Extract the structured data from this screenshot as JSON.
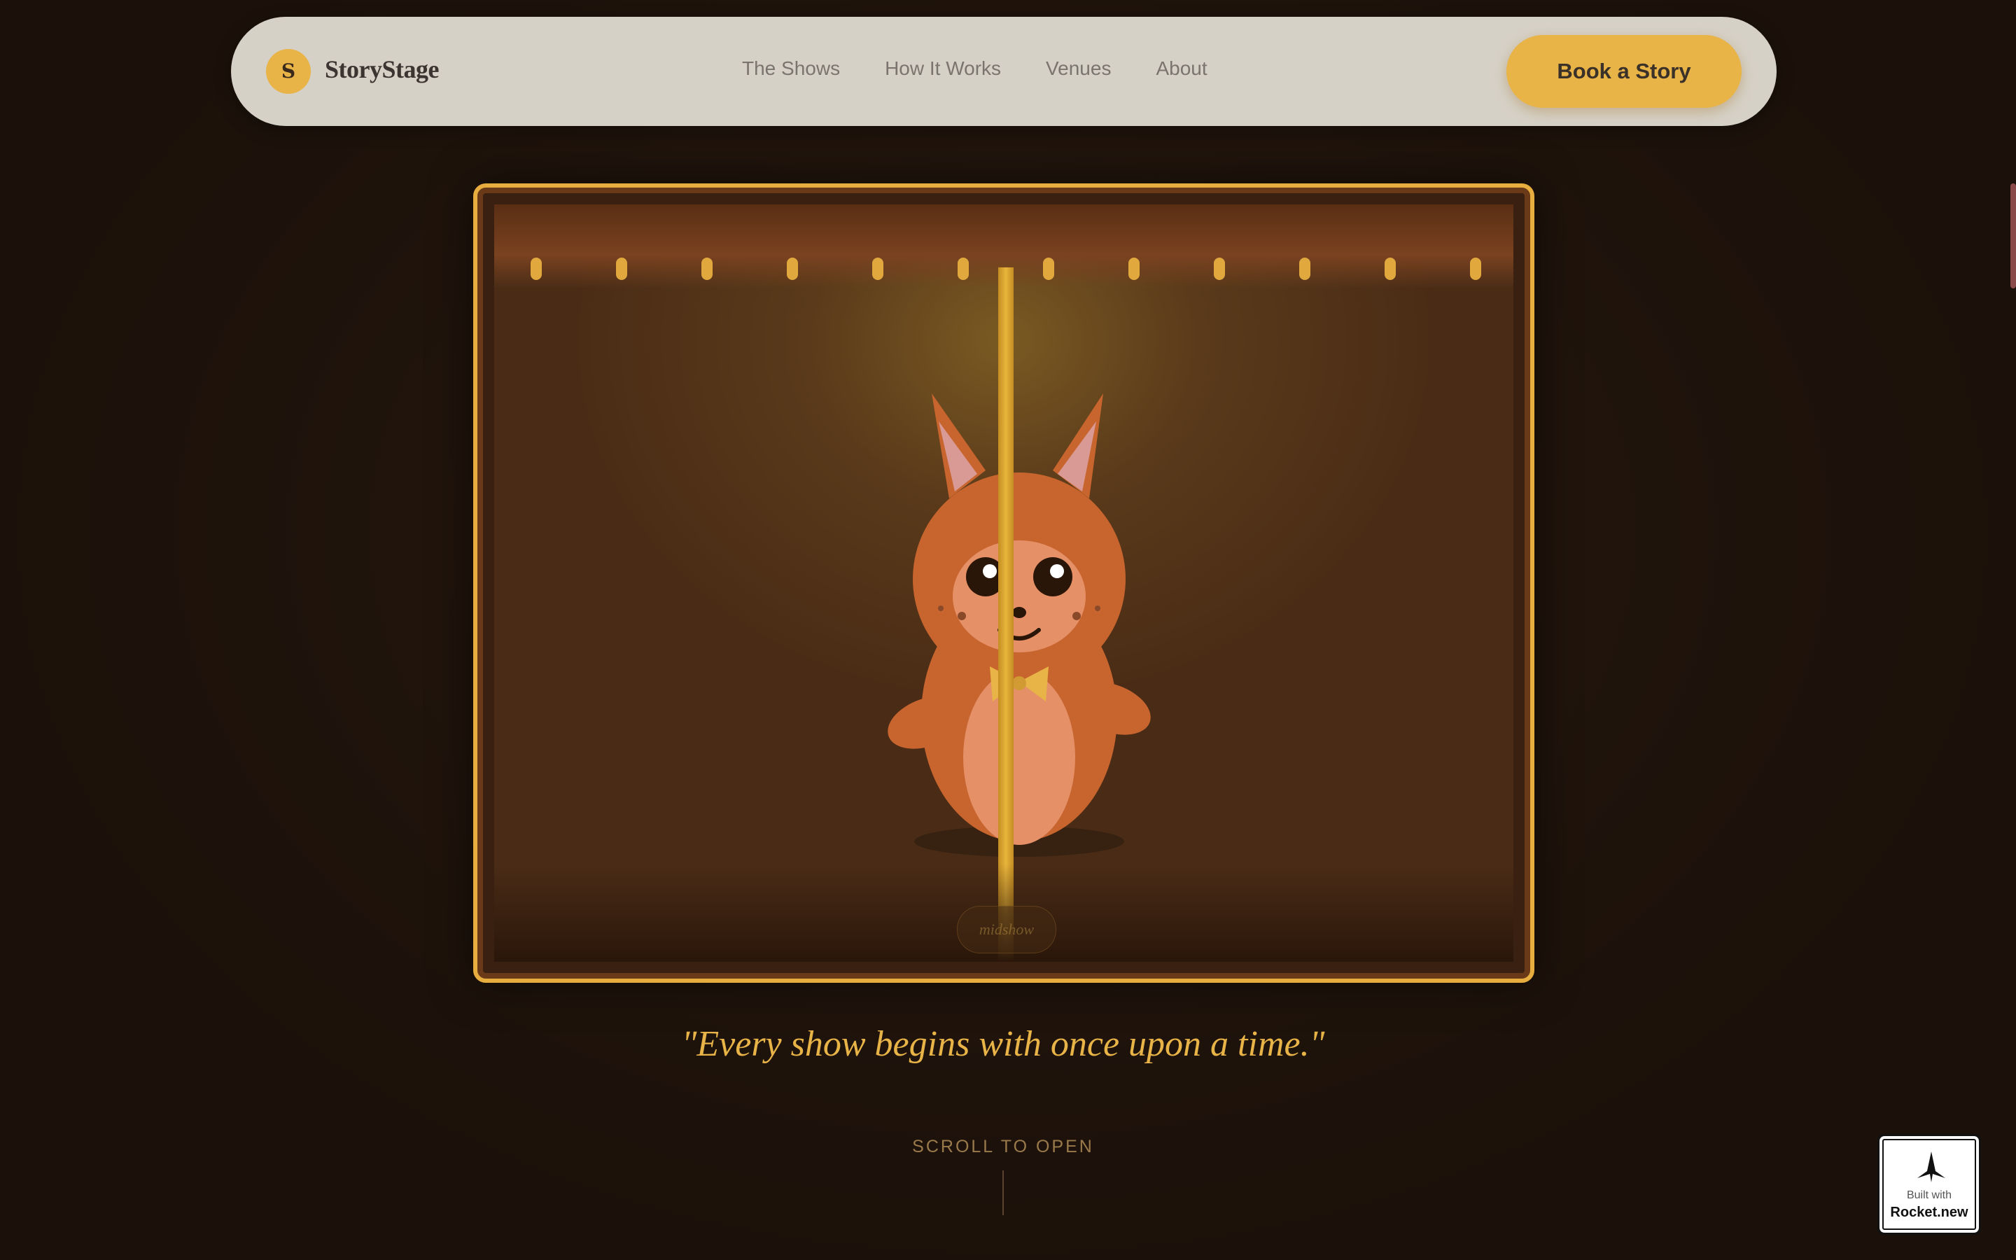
{
  "brand": {
    "initial": "S",
    "name": "StoryStage"
  },
  "nav": {
    "links": [
      "The Shows",
      "How It Works",
      "Venues",
      "About"
    ],
    "cta": "Book a Story"
  },
  "stage": {
    "label": "midshow"
  },
  "tagline": "\"Every show begins with once upon a time.\"",
  "scroll_hint": "SCROLL TO OPEN",
  "badge": {
    "built_with": "Built with",
    "name": "Rocket.new"
  },
  "colors": {
    "accent": "#e8b347",
    "background": "#1e120b",
    "nav_background": "#d6d1c7",
    "fox": "#c8652e"
  },
  "icons": [
    "rocket-icon",
    "fox-character"
  ]
}
